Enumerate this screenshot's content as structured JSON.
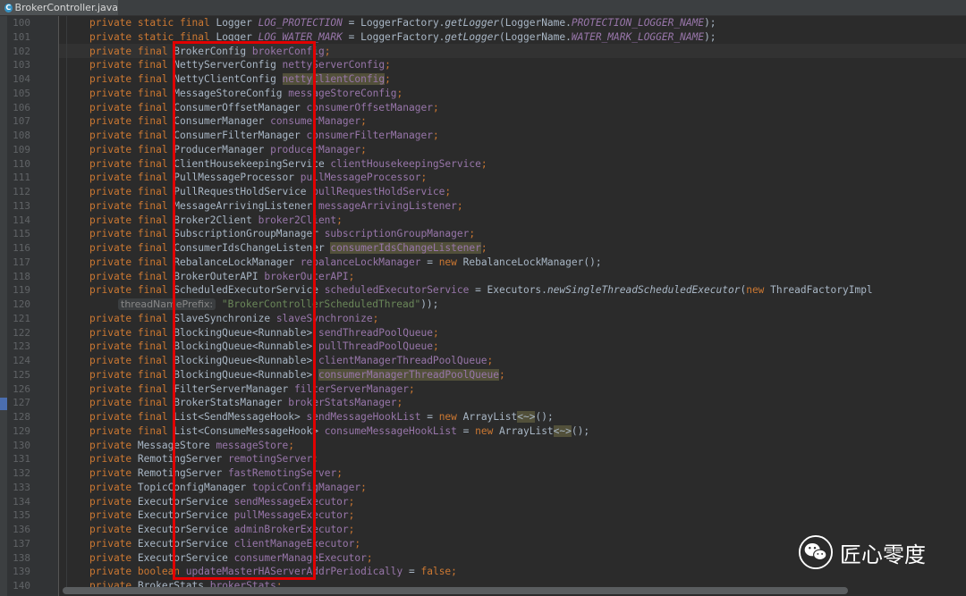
{
  "tab": {
    "title": "BrokerController.java",
    "icon": "java-class-icon"
  },
  "lines": [
    {
      "n": "100",
      "s": [
        [
          "kw",
          "private static final "
        ],
        [
          "type",
          "Logger "
        ],
        [
          "sfield",
          "LOG_PROTECTION"
        ],
        [
          "type",
          " = LoggerFactory."
        ],
        [
          "method",
          "getLogger"
        ],
        [
          "type",
          "(LoggerName."
        ],
        [
          "sfield",
          "PROTECTION_LOGGER_NAME"
        ],
        [
          "type",
          ");"
        ]
      ]
    },
    {
      "n": "101",
      "s": [
        [
          "kw",
          "private static final "
        ],
        [
          "type",
          "Logger "
        ],
        [
          "sfield",
          "LOG_WATER_MARK"
        ],
        [
          "type",
          " = LoggerFactory."
        ],
        [
          "method",
          "getLogger"
        ],
        [
          "type",
          "(LoggerName."
        ],
        [
          "sfield",
          "WATER_MARK_LOGGER_NAME"
        ],
        [
          "type",
          ");"
        ]
      ]
    },
    {
      "n": "102",
      "s": [
        [
          "kw",
          "private final "
        ],
        [
          "type",
          "BrokerConfig "
        ],
        [
          "field",
          "brokerConfig"
        ],
        [
          "kw",
          ";"
        ]
      ]
    },
    {
      "n": "103",
      "s": [
        [
          "kw",
          "private final "
        ],
        [
          "type",
          "NettyServerConfig "
        ],
        [
          "field",
          "nettyServerConfig"
        ],
        [
          "kw",
          ";"
        ]
      ]
    },
    {
      "n": "104",
      "s": [
        [
          "kw",
          "private final "
        ],
        [
          "type",
          "NettyClientConfig "
        ],
        [
          "field hl",
          "nettyClientConfig"
        ],
        [
          "kw",
          ";"
        ]
      ]
    },
    {
      "n": "105",
      "s": [
        [
          "kw",
          "private final "
        ],
        [
          "type",
          "MessageStoreConfig "
        ],
        [
          "field",
          "messageStoreConfig"
        ],
        [
          "kw",
          ";"
        ]
      ]
    },
    {
      "n": "106",
      "s": [
        [
          "kw",
          "private final "
        ],
        [
          "type",
          "ConsumerOffsetManager "
        ],
        [
          "field",
          "consumerOffsetManager"
        ],
        [
          "kw",
          ";"
        ]
      ]
    },
    {
      "n": "107",
      "s": [
        [
          "kw",
          "private final "
        ],
        [
          "type",
          "ConsumerManager "
        ],
        [
          "field",
          "consumerManager"
        ],
        [
          "kw",
          ";"
        ]
      ]
    },
    {
      "n": "108",
      "s": [
        [
          "kw",
          "private final "
        ],
        [
          "type",
          "ConsumerFilterManager "
        ],
        [
          "field",
          "consumerFilterManager"
        ],
        [
          "kw",
          ";"
        ]
      ]
    },
    {
      "n": "109",
      "s": [
        [
          "kw",
          "private final "
        ],
        [
          "type",
          "ProducerManager "
        ],
        [
          "field",
          "producerManager"
        ],
        [
          "kw",
          ";"
        ]
      ]
    },
    {
      "n": "110",
      "s": [
        [
          "kw",
          "private final "
        ],
        [
          "type",
          "ClientHousekeepingService "
        ],
        [
          "field",
          "clientHousekeepingService"
        ],
        [
          "kw",
          ";"
        ]
      ]
    },
    {
      "n": "111",
      "s": [
        [
          "kw",
          "private final "
        ],
        [
          "type",
          "PullMessageProcessor "
        ],
        [
          "field",
          "pullMessageProcessor"
        ],
        [
          "kw",
          ";"
        ]
      ]
    },
    {
      "n": "112",
      "s": [
        [
          "kw",
          "private final "
        ],
        [
          "type",
          "PullRequestHoldService "
        ],
        [
          "field",
          "pullRequestHoldService"
        ],
        [
          "kw",
          ";"
        ]
      ]
    },
    {
      "n": "113",
      "s": [
        [
          "kw",
          "private final "
        ],
        [
          "type",
          "MessageArrivingListener "
        ],
        [
          "field",
          "messageArrivingListener"
        ],
        [
          "kw",
          ";"
        ]
      ]
    },
    {
      "n": "114",
      "s": [
        [
          "kw",
          "private final "
        ],
        [
          "type",
          "Broker2Client "
        ],
        [
          "field",
          "broker2Client"
        ],
        [
          "kw",
          ";"
        ]
      ]
    },
    {
      "n": "115",
      "s": [
        [
          "kw",
          "private final "
        ],
        [
          "type",
          "SubscriptionGroupManager "
        ],
        [
          "field",
          "subscriptionGroupManager"
        ],
        [
          "kw",
          ";"
        ]
      ]
    },
    {
      "n": "116",
      "s": [
        [
          "kw",
          "private final "
        ],
        [
          "type",
          "ConsumerIdsChangeListener "
        ],
        [
          "field hl",
          "consumerIdsChangeListener"
        ],
        [
          "kw",
          ";"
        ]
      ]
    },
    {
      "n": "117",
      "s": [
        [
          "kw",
          "private final "
        ],
        [
          "type",
          "RebalanceLockManager "
        ],
        [
          "field",
          "rebalanceLockManager"
        ],
        [
          "type",
          " = "
        ],
        [
          "kw",
          "new "
        ],
        [
          "type",
          "RebalanceLockManager();"
        ]
      ]
    },
    {
      "n": "118",
      "s": [
        [
          "kw",
          "private final "
        ],
        [
          "type",
          "BrokerOuterAPI "
        ],
        [
          "field",
          "brokerOuterAPI"
        ],
        [
          "kw",
          ";"
        ]
      ]
    },
    {
      "n": "119",
      "s": [
        [
          "kw",
          "private final "
        ],
        [
          "type",
          "ScheduledExecutorService "
        ],
        [
          "field",
          "scheduledExecutorService"
        ],
        [
          "type",
          " = Executors."
        ],
        [
          "method",
          "newSingleThreadScheduledExecutor"
        ],
        [
          "type",
          "("
        ],
        [
          "kw",
          "new "
        ],
        [
          "type",
          "ThreadFactoryImpl"
        ]
      ]
    },
    {
      "n": "120",
      "hint": "threadNamePrefix:",
      "s": [
        [
          "str",
          "\"BrokerControllerScheduledThread\""
        ],
        [
          "type",
          "));"
        ]
      ]
    },
    {
      "n": "121",
      "s": [
        [
          "kw",
          "private final "
        ],
        [
          "type",
          "SlaveSynchronize "
        ],
        [
          "field",
          "slaveSynchronize"
        ],
        [
          "kw",
          ";"
        ]
      ]
    },
    {
      "n": "122",
      "s": [
        [
          "kw",
          "private final "
        ],
        [
          "type",
          "BlockingQueue<Runnable> "
        ],
        [
          "field",
          "sendThreadPoolQueue"
        ],
        [
          "kw",
          ";"
        ]
      ]
    },
    {
      "n": "123",
      "s": [
        [
          "kw",
          "private final "
        ],
        [
          "type",
          "BlockingQueue<Runnable> "
        ],
        [
          "field",
          "pullThreadPoolQueue"
        ],
        [
          "kw",
          ";"
        ]
      ]
    },
    {
      "n": "124",
      "s": [
        [
          "kw",
          "private final "
        ],
        [
          "type",
          "BlockingQueue<Runnable> "
        ],
        [
          "field",
          "clientManagerThreadPoolQueue"
        ],
        [
          "kw",
          ";"
        ]
      ]
    },
    {
      "n": "125",
      "s": [
        [
          "kw",
          "private final "
        ],
        [
          "type",
          "BlockingQueue<Runnable> "
        ],
        [
          "field hl",
          "consumerManagerThreadPoolQueue"
        ],
        [
          "kw",
          ";"
        ]
      ]
    },
    {
      "n": "126",
      "s": [
        [
          "kw",
          "private final "
        ],
        [
          "type",
          "FilterServerManager "
        ],
        [
          "field",
          "filterServerManager"
        ],
        [
          "kw",
          ";"
        ]
      ]
    },
    {
      "n": "127",
      "s": [
        [
          "kw",
          "private final "
        ],
        [
          "type",
          "BrokerStatsManager "
        ],
        [
          "field",
          "brokerStatsManager"
        ],
        [
          "kw",
          ";"
        ]
      ]
    },
    {
      "n": "128",
      "s": [
        [
          "kw",
          "private final "
        ],
        [
          "type",
          "List<SendMessageHook> "
        ],
        [
          "field",
          "sendMessageHookList"
        ],
        [
          "type",
          " = "
        ],
        [
          "kw",
          "new "
        ],
        [
          "type",
          "ArrayList"
        ],
        [
          "type hl",
          "<~>"
        ],
        [
          "type",
          "();"
        ]
      ]
    },
    {
      "n": "129",
      "s": [
        [
          "kw",
          "private final "
        ],
        [
          "type",
          "List<ConsumeMessageHook> "
        ],
        [
          "field",
          "consumeMessageHookList"
        ],
        [
          "type",
          " = "
        ],
        [
          "kw",
          "new "
        ],
        [
          "type",
          "ArrayList"
        ],
        [
          "type hl",
          "<~>"
        ],
        [
          "type",
          "();"
        ]
      ]
    },
    {
      "n": "130",
      "s": [
        [
          "kw",
          "private "
        ],
        [
          "type",
          "MessageStore "
        ],
        [
          "field",
          "messageStore"
        ],
        [
          "kw",
          ";"
        ]
      ]
    },
    {
      "n": "131",
      "s": [
        [
          "kw",
          "private "
        ],
        [
          "type",
          "RemotingServer "
        ],
        [
          "field",
          "remotingServer"
        ],
        [
          "kw",
          ";"
        ]
      ]
    },
    {
      "n": "132",
      "s": [
        [
          "kw",
          "private "
        ],
        [
          "type",
          "RemotingServer "
        ],
        [
          "field",
          "fastRemotingServer"
        ],
        [
          "kw",
          ";"
        ]
      ]
    },
    {
      "n": "133",
      "s": [
        [
          "kw",
          "private "
        ],
        [
          "type",
          "TopicConfigManager "
        ],
        [
          "field",
          "topicConfigManager"
        ],
        [
          "kw",
          ";"
        ]
      ]
    },
    {
      "n": "134",
      "s": [
        [
          "kw",
          "private "
        ],
        [
          "type",
          "ExecutorService "
        ],
        [
          "field",
          "sendMessageExecutor"
        ],
        [
          "kw",
          ";"
        ]
      ]
    },
    {
      "n": "135",
      "s": [
        [
          "kw",
          "private "
        ],
        [
          "type",
          "ExecutorService "
        ],
        [
          "field",
          "pullMessageExecutor"
        ],
        [
          "kw",
          ";"
        ]
      ]
    },
    {
      "n": "136",
      "s": [
        [
          "kw",
          "private "
        ],
        [
          "type",
          "ExecutorService "
        ],
        [
          "field",
          "adminBrokerExecutor"
        ],
        [
          "kw",
          ";"
        ]
      ]
    },
    {
      "n": "137",
      "s": [
        [
          "kw",
          "private "
        ],
        [
          "type",
          "ExecutorService "
        ],
        [
          "field",
          "clientManageExecutor"
        ],
        [
          "kw",
          ";"
        ]
      ]
    },
    {
      "n": "138",
      "s": [
        [
          "kw",
          "private "
        ],
        [
          "type",
          "ExecutorService "
        ],
        [
          "field",
          "consumerManageExecutor"
        ],
        [
          "kw",
          ";"
        ]
      ]
    },
    {
      "n": "139",
      "s": [
        [
          "kw",
          "private "
        ],
        [
          "kw",
          "boolean "
        ],
        [
          "field",
          "updateMasterHAServerAddrPeriodically"
        ],
        [
          "type",
          " = "
        ],
        [
          "kw",
          "false"
        ],
        [
          "kw",
          ";"
        ]
      ]
    },
    {
      "n": "140",
      "s": [
        [
          "kw",
          "private "
        ],
        [
          "type",
          "BrokerStats "
        ],
        [
          "field",
          "brokerStats"
        ],
        [
          "kw",
          ";"
        ]
      ]
    }
  ],
  "watermark": {
    "text": "匠心零度",
    "icon": "wechat-icon"
  },
  "colors": {
    "highlight_box": "#e20000",
    "background": "#2b2b2b",
    "keyword": "#cc7832",
    "field": "#9876aa",
    "string": "#6a8759"
  }
}
